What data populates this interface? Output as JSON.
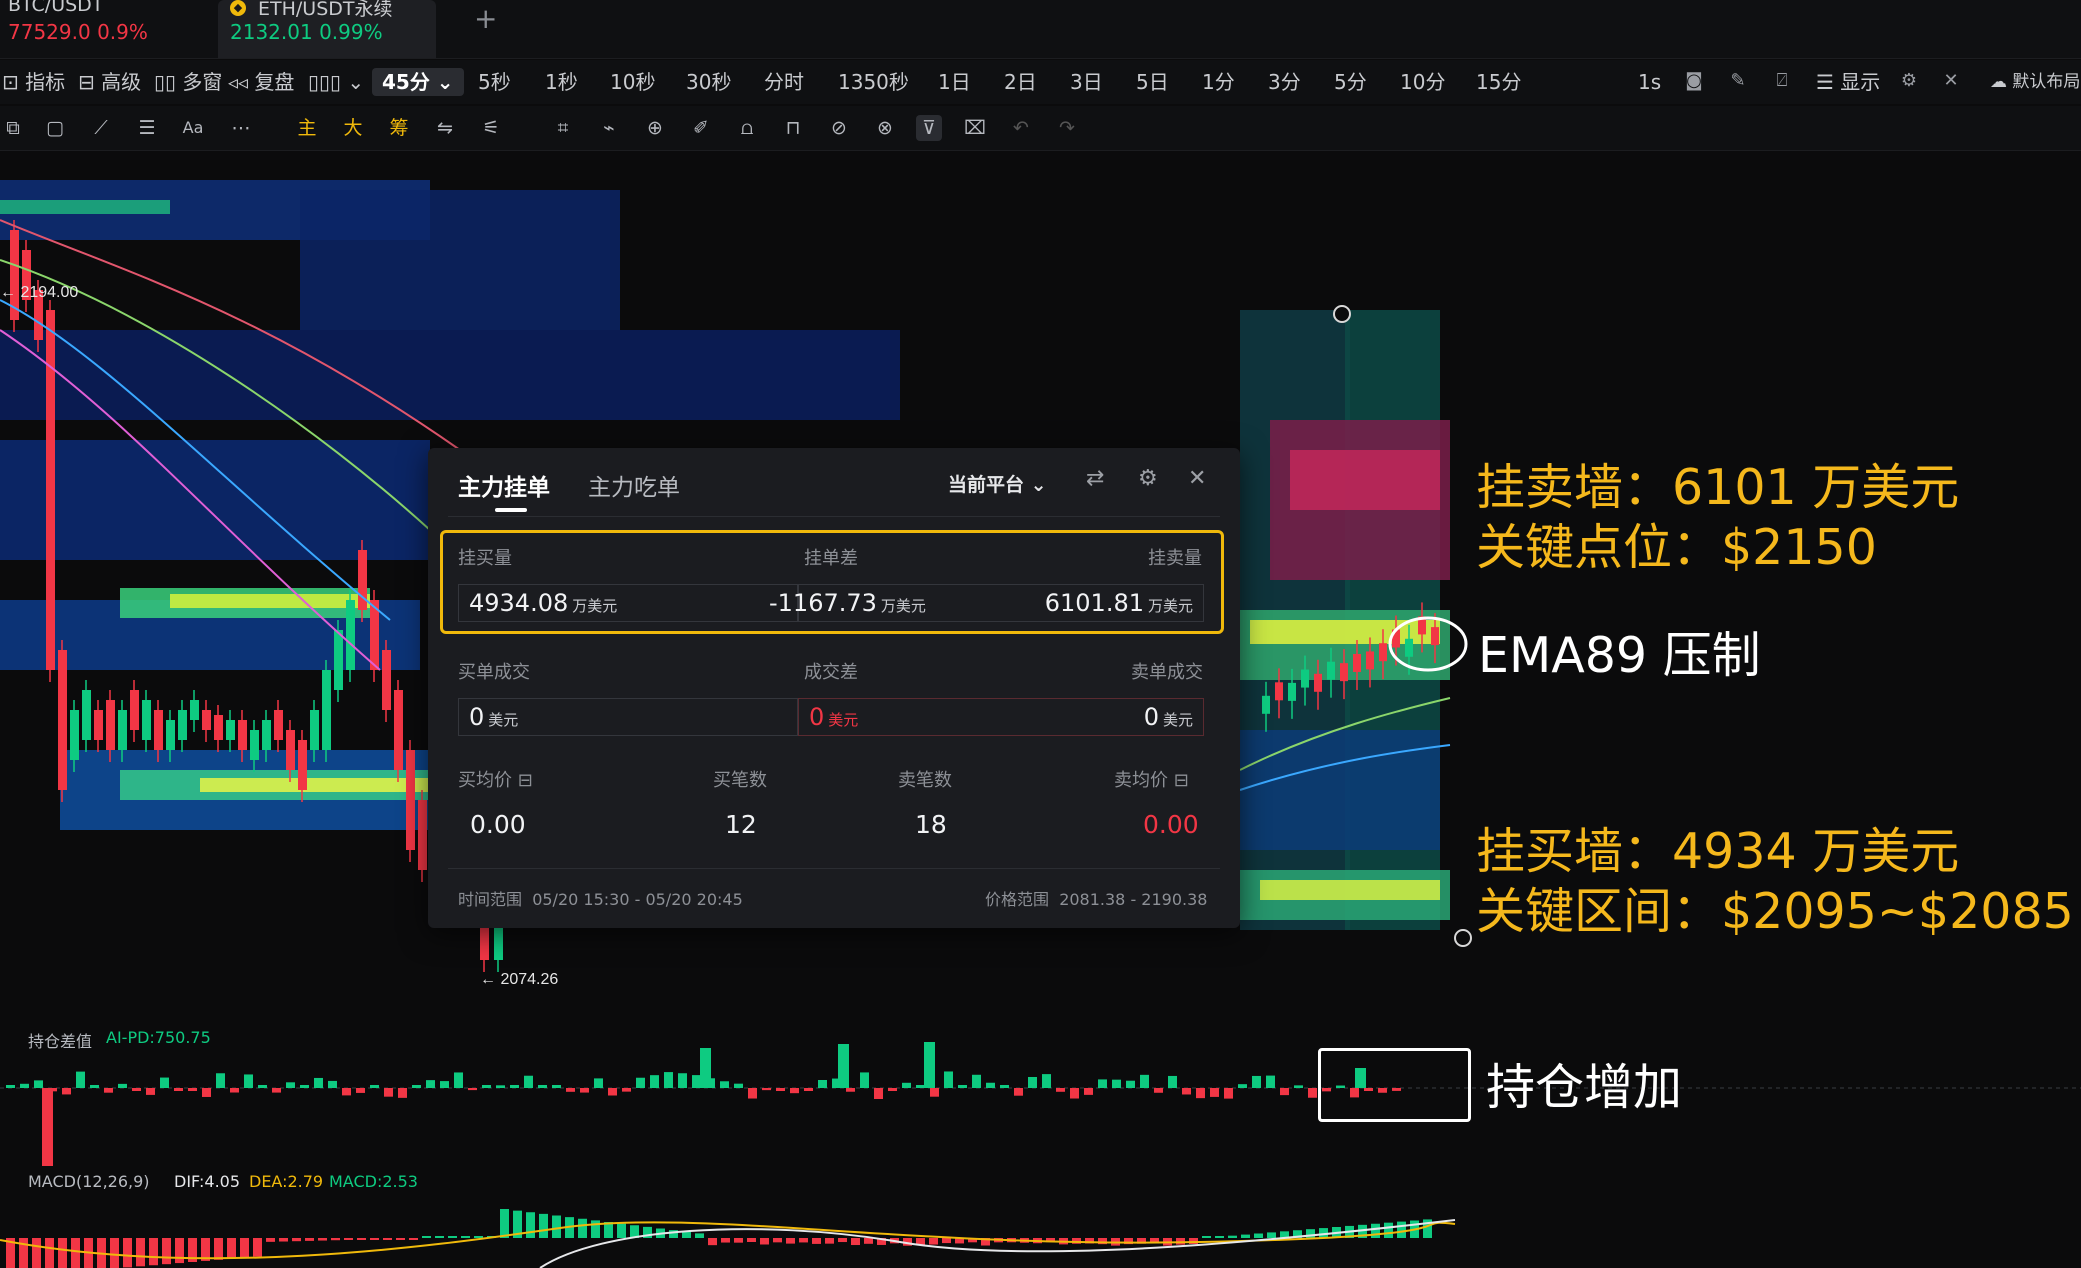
{
  "tabs": [
    {
      "symbol": "BTC/USDT",
      "price": "77529.0",
      "change": "0.9%"
    },
    {
      "symbol": "ETH/USDT永续",
      "price": "2132.01",
      "change": "0.99%"
    }
  ],
  "toolbar1": {
    "left": [
      "指标",
      "高级",
      "多窗",
      "复盘"
    ],
    "active_interval": "45分",
    "intervals": [
      "5秒",
      "1秒",
      "10秒",
      "30秒",
      "分时",
      "1350秒",
      "1日",
      "2日",
      "3日",
      "5日",
      "1分",
      "3分",
      "5分",
      "10分",
      "15分"
    ],
    "right_interval": "1s",
    "display_label": "显示",
    "layout_label": "默认布局"
  },
  "toolbar2": {
    "chart_types": [
      "主",
      "大",
      "筹"
    ]
  },
  "chart": {
    "high_label": "← 2194.00",
    "low_label": "← 2074.26",
    "colors": {
      "up": "#0ecb81",
      "down": "#f23645",
      "accent": "#f0b90b"
    }
  },
  "panel": {
    "tabs": [
      "主力挂单",
      "主力吃单"
    ],
    "platform": "当前平台",
    "row1": {
      "labels": [
        "挂买量",
        "挂单差",
        "挂卖量"
      ],
      "values": [
        "4934.08",
        "-1167.73",
        "6101.81"
      ],
      "unit": "万美元"
    },
    "row2": {
      "labels": [
        "买单成交",
        "成交差",
        "卖单成交"
      ],
      "values": [
        "0",
        "0",
        "0"
      ],
      "unit": "美元"
    },
    "row3": {
      "labels": [
        "买均价",
        "买笔数",
        "卖笔数",
        "卖均价"
      ],
      "values": [
        "0.00",
        "12",
        "18",
        "0.00"
      ]
    },
    "time_range_label": "时间范围",
    "time_range": "05/20 15:30 - 05/20 20:45",
    "price_range_label": "价格范围",
    "price_range": "2081.38 - 2190.38"
  },
  "annotations": {
    "sell_wall": "挂卖墙：6101 万美元",
    "sell_key": "关键点位：$2150",
    "ema": "EMA89 压制",
    "buy_wall": "挂买墙：4934 万美元",
    "buy_key": "关键区间：$2095~$2085",
    "oi": "持仓增加"
  },
  "indicators": {
    "oi_label": "持仓差值",
    "oi_value": "AI-PD:750.75",
    "macd_label": "MACD(12,26,9)",
    "dif": "DIF:4.05",
    "dea": "DEA:2.79",
    "macd": "MACD:2.53"
  }
}
